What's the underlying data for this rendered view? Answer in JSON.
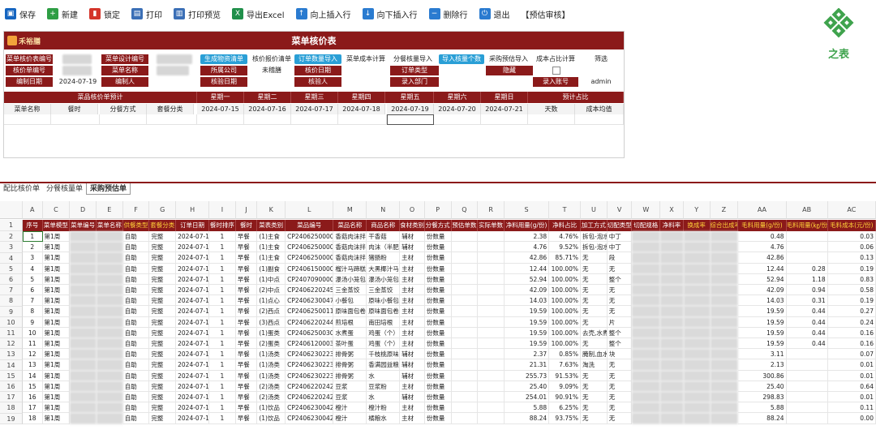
{
  "toolbar": {
    "items": [
      {
        "label": "保存",
        "icon": "save-icon",
        "color": "#1565c0"
      },
      {
        "label": "新建",
        "icon": "add-icon",
        "color": "#2e9e44"
      },
      {
        "label": "锁定",
        "icon": "lock-icon",
        "color": "#d4342a"
      },
      {
        "label": "打印",
        "icon": "print-icon",
        "color": "#3b6fb6"
      },
      {
        "label": "打印预览",
        "icon": "print-preview-icon",
        "color": "#3b6fb6"
      },
      {
        "label": "导出Excel",
        "icon": "excel-icon",
        "color": "#1f8f4a"
      },
      {
        "label": "向上插入行",
        "icon": "insert-above-icon",
        "color": "#2a7bd0"
      },
      {
        "label": "向下插入行",
        "icon": "insert-below-icon",
        "color": "#2a7bd0"
      },
      {
        "label": "删除行",
        "icon": "delete-row-icon",
        "color": "#2a7bd0"
      },
      {
        "label": "退出",
        "icon": "power-icon",
        "color": "#2a7bd0"
      },
      {
        "label": "【预估审核】",
        "icon": "",
        "color": "#222222"
      }
    ]
  },
  "brand": {
    "text": "之表",
    "color": "#3fa34d"
  },
  "form": {
    "title": "菜单核价表",
    "logo_text": "禾裕膳",
    "row1": {
      "label1": "菜单核价表编号",
      "label2": "菜单设计编号",
      "btn1": "生成物资清单",
      "text1": "核价报价清单",
      "btn2": "订单数量导入",
      "text2": "菜单成本计算",
      "text3": "分餐核量导入",
      "btn3": "导入核量个数",
      "text4": "采购预估导入",
      "text5": "成本占比计算",
      "text6": "筛选"
    },
    "row2": {
      "label1": "核价单编号",
      "label2": "菜单名称",
      "label3": "所属公司",
      "value3": "未稽膳",
      "label4": "核价日期",
      "label5": "订单类型",
      "label6": "隐藏"
    },
    "row3": {
      "label1": "编制日期",
      "value1": "2024-07-19",
      "label2": "编制人",
      "label3": "核验日期",
      "label4": "核验人",
      "label5": "录入部门",
      "label6": "录入账号",
      "value6": "admin"
    },
    "header_band": {
      "group1": "菜品核价单预计",
      "days": [
        "星期一",
        "星期二",
        "星期三",
        "星期四",
        "星期五",
        "星期六",
        "星期日"
      ],
      "group2": "预计占比"
    },
    "sub_header": {
      "cols": [
        "菜单名称",
        "餐时",
        "分餐方式",
        "套餐分类"
      ],
      "dates": [
        "2024-07-15",
        "2024-07-16",
        "2024-07-17",
        "2024-07-18",
        "2024-07-19",
        "2024-07-20",
        "2024-07-21"
      ],
      "tail": [
        "天数",
        "成本均值"
      ]
    }
  },
  "sheet_tabs": [
    {
      "label": "配比核价单",
      "active": false
    },
    {
      "label": "分餐核量单",
      "active": false
    },
    {
      "label": "采购预估单",
      "active": true
    }
  ],
  "sheet": {
    "col_letters": [
      "A",
      "C",
      "D",
      "E",
      "F",
      "G",
      "H",
      "I",
      "J",
      "K",
      "L",
      "M",
      "N",
      "O",
      "P",
      "Q",
      "R",
      "S",
      "T",
      "U",
      "V",
      "W",
      "X",
      "Y",
      "Z",
      "AA",
      "AB",
      "AC"
    ],
    "headers": [
      "序号",
      "菜单模型",
      "菜单编号",
      "菜单名称",
      "供餐类型",
      "套餐分类",
      "订单日期",
      "餐时排序",
      "餐时",
      "菜表类别",
      "菜品编号",
      "菜品名称",
      "商品名称",
      "食材类别",
      "分餐方式",
      "预估单数",
      "实际单数",
      "净料用量(g/份)",
      "净料占比",
      "加工方式",
      "切配类型",
      "切配规格",
      "净料率",
      "换成率",
      "综合出成率",
      "毛料用量(g/份)",
      "毛料用量(㎏/份)",
      "毛料成本(元/份)"
    ],
    "header_yellow": [
      4,
      5,
      23,
      24,
      25,
      26,
      27
    ],
    "rows": [
      [
        "1",
        "第1周",
        "",
        "",
        "自助",
        "完整",
        "2024-07-15",
        "1",
        "早餐",
        "(1)主食",
        "CP24062500009",
        "香菇肉沫拌面",
        "干香菇",
        "辅材",
        "份数量",
        "",
        "",
        "2.38",
        "4.76%",
        "拆包-泡水",
        "中丁",
        "",
        "",
        "",
        "",
        "0.48",
        "",
        "0.03"
      ],
      [
        "2",
        "第1周",
        "",
        "",
        "自助",
        "完整",
        "2024-07-15",
        "1",
        "早餐",
        "(1)主食",
        "CP24062500009",
        "香菇肉沫拌面",
        "肉沫（半肥）",
        "辅材",
        "份数量",
        "",
        "",
        "4.76",
        "9.52%",
        "拆包-泡水",
        "中丁",
        "",
        "",
        "",
        "",
        "4.76",
        "",
        "0.06"
      ],
      [
        "3",
        "第1周",
        "",
        "",
        "自助",
        "完整",
        "2024-07-15",
        "1",
        "早餐",
        "(1)主食",
        "CP24062500009",
        "香菇肉沫拌面",
        "猪肠粉",
        "主材",
        "份数量",
        "",
        "",
        "42.86",
        "85.71%",
        "无",
        "段",
        "",
        "",
        "",
        "",
        "42.86",
        "",
        "0.13"
      ],
      [
        "4",
        "第1周",
        "",
        "",
        "自助",
        "完整",
        "2024-07-15",
        "1",
        "早餐",
        "(1)副食",
        "CP24061500002",
        "榴汁马蹄糕",
        "大黑椰汁马蹄糕",
        "主材",
        "份数量",
        "",
        "",
        "12.44",
        "100.00%",
        "无",
        "无",
        "",
        "",
        "",
        "",
        "12.44",
        "0.28",
        "0.19"
      ],
      [
        "5",
        "第1周",
        "",
        "",
        "自助",
        "完整",
        "2024-07-15",
        "1",
        "早餐",
        "(1)中点",
        "CP24070900002",
        "瀑汤小笼包",
        "瀑汤小笼包",
        "主材",
        "份数量",
        "",
        "",
        "52.94",
        "100.00%",
        "无",
        "整个",
        "",
        "",
        "",
        "",
        "52.94",
        "1.18",
        "0.83"
      ],
      [
        "6",
        "第1周",
        "",
        "",
        "自助",
        "完整",
        "2024-07-15",
        "1",
        "早餐",
        "(2)中点",
        "CP24062202454",
        "三金蒸饺",
        "三金蒸饺",
        "主材",
        "份数量",
        "",
        "",
        "42.09",
        "100.00%",
        "无",
        "无",
        "",
        "",
        "",
        "",
        "42.09",
        "0.94",
        "0.58"
      ],
      [
        "7",
        "第1周",
        "",
        "",
        "自助",
        "完整",
        "2024-07-15",
        "1",
        "早餐",
        "(1)点心",
        "CP24062300471",
        "小餐包",
        "原味小餐包",
        "主材",
        "份数量",
        "",
        "",
        "14.03",
        "100.00%",
        "无",
        "无",
        "",
        "",
        "",
        "",
        "14.03",
        "0.31",
        "0.19"
      ],
      [
        "8",
        "第1周",
        "",
        "",
        "自助",
        "完整",
        "2024-07-15",
        "1",
        "早餐",
        "(2)西点",
        "CP24062500115",
        "原味面包卷",
        "原味面包卷",
        "主材",
        "份数量",
        "",
        "",
        "19.59",
        "100.00%",
        "无",
        "无",
        "",
        "",
        "",
        "",
        "19.59",
        "0.44",
        "0.27"
      ],
      [
        "9",
        "第1周",
        "",
        "",
        "自助",
        "完整",
        "2024-07-15",
        "1",
        "早餐",
        "(3)西点",
        "CP24062202442",
        "煎培根",
        "南田培根",
        "主材",
        "份数量",
        "",
        "",
        "19.59",
        "100.00%",
        "无",
        "片",
        "",
        "",
        "",
        "",
        "19.59",
        "0.44",
        "0.24"
      ],
      [
        "10",
        "第1周",
        "",
        "",
        "自助",
        "完整",
        "2024-07-15",
        "1",
        "早餐",
        "(1)蛋类",
        "CP24062500304",
        "水煮蛋",
        "鸡蛋（个）",
        "主材",
        "份数量",
        "",
        "",
        "19.59",
        "100.00%",
        "去壳,水煮",
        "整个",
        "",
        "",
        "",
        "",
        "19.59",
        "0.44",
        "0.16"
      ],
      [
        "11",
        "第1周",
        "",
        "",
        "自助",
        "完整",
        "2024-07-15",
        "1",
        "早餐",
        "(2)蛋类",
        "CP24061200039",
        "茶叶蛋",
        "鸡蛋（个）",
        "主材",
        "份数量",
        "",
        "",
        "19.59",
        "100.00%",
        "无",
        "整个",
        "",
        "",
        "",
        "",
        "19.59",
        "0.44",
        "0.16"
      ],
      [
        "12",
        "第1周",
        "",
        "",
        "自助",
        "完整",
        "2024-07-15",
        "1",
        "早餐",
        "(1)汤类",
        "CP24062302234",
        "排骨粥",
        "千枝桃原味大米",
        "辅材",
        "份数量",
        "",
        "",
        "2.37",
        "0.85%",
        "腌制,血水",
        "块",
        "",
        "",
        "",
        "",
        "3.11",
        "",
        "0.07"
      ],
      [
        "13",
        "第1周",
        "",
        "",
        "自助",
        "完整",
        "2024-07-15",
        "1",
        "早餐",
        "(1)汤类",
        "CP24062302234",
        "排骨粥",
        "香满园益粮粗米",
        "辅材",
        "份数量",
        "",
        "",
        "21.31",
        "7.63%",
        "淘洗",
        "无",
        "",
        "",
        "",
        "",
        "2.13",
        "",
        "0.01"
      ],
      [
        "14",
        "第1周",
        "",
        "",
        "自助",
        "完整",
        "2024-07-15",
        "1",
        "早餐",
        "(1)汤类",
        "CP24062302234",
        "排骨粥",
        "水",
        "辅材",
        "份数量",
        "",
        "",
        "255.73",
        "91.53%",
        "无",
        "无",
        "",
        "",
        "",
        "",
        "300.86",
        "",
        "0.01"
      ],
      [
        "15",
        "第1周",
        "",
        "",
        "自助",
        "完整",
        "2024-07-15",
        "1",
        "早餐",
        "(2)汤类",
        "CP24062202426",
        "豆浆",
        "豆浆粉",
        "主材",
        "份数量",
        "",
        "",
        "25.40",
        "9.09%",
        "无",
        "无",
        "",
        "",
        "",
        "",
        "25.40",
        "",
        "0.64"
      ],
      [
        "16",
        "第1周",
        "",
        "",
        "自助",
        "完整",
        "2024-07-15",
        "1",
        "早餐",
        "(2)汤类",
        "CP24062202426",
        "豆浆",
        "水",
        "辅材",
        "份数量",
        "",
        "",
        "254.01",
        "90.91%",
        "无",
        "无",
        "",
        "",
        "",
        "",
        "298.83",
        "",
        "0.01"
      ],
      [
        "17",
        "第1周",
        "",
        "",
        "自助",
        "完整",
        "2024-07-15",
        "1",
        "早餐",
        "(1)饮品",
        "CP24062300421",
        "橙汁",
        "橙汁粉",
        "主材",
        "份数量",
        "",
        "",
        "5.88",
        "6.25%",
        "无",
        "无",
        "",
        "",
        "",
        "",
        "5.88",
        "",
        "0.11"
      ],
      [
        "18",
        "第1周",
        "",
        "",
        "自助",
        "完整",
        "2024-07-15",
        "1",
        "早餐",
        "(1)饮品",
        "CP24062300421",
        "橙汁",
        "橘粮水",
        "主材",
        "份数量",
        "",
        "",
        "88.24",
        "93.75%",
        "无",
        "无",
        "",
        "",
        "",
        "",
        "88.24",
        "",
        "0.00"
      ]
    ]
  }
}
